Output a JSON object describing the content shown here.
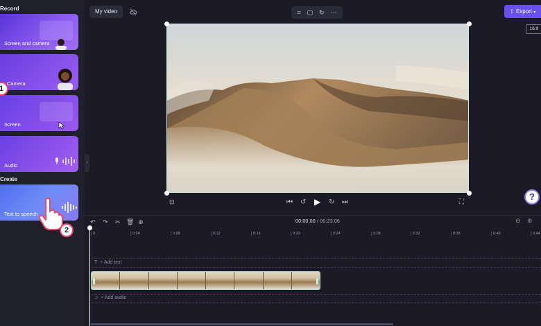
{
  "sidebar": {
    "record_label": "Record",
    "create_label": "Create",
    "cards": [
      {
        "label": "Screen and camera",
        "icon": "screen-and-camera-icon"
      },
      {
        "label": "Camera",
        "icon": "camera-person-icon"
      },
      {
        "label": "Screen",
        "icon": "screen-cursor-icon"
      },
      {
        "label": "Audio",
        "icon": "microphone-icon"
      },
      {
        "label": "Text to speech",
        "icon": "speech-wave-icon"
      }
    ]
  },
  "topbar": {
    "project_title": "My video",
    "export_label": "Export",
    "aspect_ratio": "16:9"
  },
  "player": {
    "current_time": "00:00.00",
    "duration": "/ 00:23.06"
  },
  "timeline": {
    "ticks": [
      "0",
      "0:04",
      "0:08",
      "0:12",
      "0:16",
      "0:20",
      "0:24",
      "0:28",
      "0:32",
      "0:36",
      "0:40",
      "0:44"
    ],
    "add_text": "+ Add text",
    "add_audio": "+ Add audio",
    "clip_frames": 8
  },
  "tutorial": {
    "step_one": "1",
    "step_two": "2"
  },
  "help_label": "?",
  "colors": {
    "accent": "#6a4ff0",
    "clip_border": "#9de3d5",
    "background": "#1b1a26",
    "panel": "#201f2c"
  }
}
